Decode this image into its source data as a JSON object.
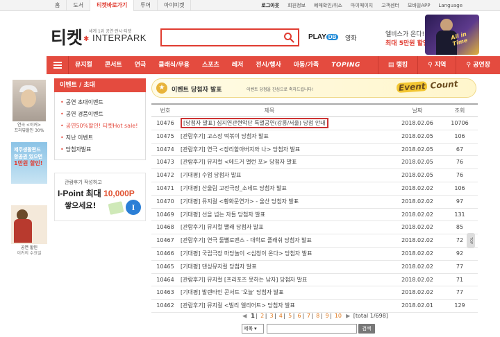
{
  "topbar": {
    "left_tabs": [
      "홈",
      "도서",
      "티켓바로가기",
      "투어",
      "아이미켓"
    ],
    "right_links": [
      "로그아웃",
      "회원정보",
      "예매확인/취소",
      "마이페이지",
      "고객센터",
      "모바일APP",
      "Language"
    ]
  },
  "header": {
    "logo_ticket": "티켓",
    "logo_sub": "세계 1위 공연·전시·티켓",
    "logo_interpark": "INTERPARK",
    "playdb": "PLAY",
    "playdb_badge": "DB",
    "movie": "영화",
    "promo_line1": "엘비스가 온다!",
    "promo_line2": "최대 5만원 할인",
    "promo_art_text": "All in Time"
  },
  "nav": {
    "items": [
      "뮤지컬",
      "콘서트",
      "연극",
      "클래식/무용",
      "스포츠",
      "레저",
      "전시/행사",
      "아동/가족",
      "TOPING"
    ],
    "right_items": [
      "랭킹",
      "지역",
      "공연장"
    ]
  },
  "left_banners": {
    "b1_caption1": "연극 <이커>",
    "b1_caption2": "프리뷰할인 30%",
    "b2_text1": "제주생활편드",
    "b2_text2": "항공권 있으면",
    "b2_text3": "1만원 할인!",
    "b3_caption1": "공연 할인",
    "b3_caption2": "이커의 수요일"
  },
  "event_sidebar": {
    "header": "이벤트 / 초대",
    "items": [
      {
        "label": "공연 초대이벤트",
        "hot": false
      },
      {
        "label": "공연 경품이벤트",
        "hot": false
      },
      {
        "label": "공연50%할인! 티켓Hot sale!",
        "hot": true
      },
      {
        "label": "지난 이벤트",
        "hot": false
      },
      {
        "label": "당첨자발표",
        "hot": false
      }
    ],
    "ipoint": {
      "line1": "관람후기 작성하고",
      "line2_prefix": "I-Point 최대 ",
      "line2_num": "10,000P",
      "line3": "쌓으세요!",
      "badge": "I"
    }
  },
  "main": {
    "title": "이벤트 당첨자 발표",
    "subtitle": "이벤트 당첨을 진심으로 축하드립니다!",
    "banner_logo": "Event",
    "banner_logo_suffix": "Count",
    "columns": {
      "num": "번호",
      "title": "제목",
      "date": "날짜",
      "views": "조회"
    },
    "rows": [
      {
        "num": "10476",
        "title": "[당첨자 발표] 심지연관현악단 특별공연(강릉/서울) 당첨 안내",
        "date": "2018.02.06",
        "views": "10706",
        "highlight": true
      },
      {
        "num": "10475",
        "title": "[관람후기] 고스장 떡볶이 당첨자 발표",
        "date": "2018.02.05",
        "views": "106"
      },
      {
        "num": "10474",
        "title": "[관람후기] 연극 <장리할아버지와 나> 당첨자 발표",
        "date": "2018.02.05",
        "views": "67"
      },
      {
        "num": "10473",
        "title": "[관람후기] 뮤지컬 <에드거 앨런 포> 당첨자 발표",
        "date": "2018.02.05",
        "views": "76"
      },
      {
        "num": "10472",
        "title": "[기대평] 수업 당첨자 발표",
        "date": "2018.02.05",
        "views": "76"
      },
      {
        "num": "10471",
        "title": "[기대평] 산울림 고전극장_소네트 당첨자 발표",
        "date": "2018.02.02",
        "views": "106"
      },
      {
        "num": "10470",
        "title": "[기대평] 뮤지컬 <황화문연가> - 울산 당첨자 발표",
        "date": "2018.02.02",
        "views": "97"
      },
      {
        "num": "10469",
        "title": "[기대평] 선을 넘는 자들 당첨자 발표",
        "date": "2018.02.02",
        "views": "131"
      },
      {
        "num": "10468",
        "title": "[관람후기] 뮤지컬 빨래 당첨자 발표",
        "date": "2018.02.02",
        "views": "85"
      },
      {
        "num": "10467",
        "title": "[관람후기] 연극 둘뻘로맨스 - 대학로 플래쉬 당첨자 발표",
        "date": "2018.02.02",
        "views": "72"
      },
      {
        "num": "10466",
        "title": "[기대평] 국립극장 마당놀이 <심청이 온다> 당첨자 발표",
        "date": "2018.02.02",
        "views": "92"
      },
      {
        "num": "10465",
        "title": "[기대평] 댄싱뮤지컬 당첨자 발표",
        "date": "2018.02.02",
        "views": "77"
      },
      {
        "num": "10464",
        "title": "[관람후기] 뮤지컬 [프리포즈 못하는 남자] 당첨자 발표",
        "date": "2018.02.02",
        "views": "71"
      },
      {
        "num": "10463",
        "title": "[기대평] 발렌타인 콘서트 '오늘' 당첨자 발표",
        "date": "2018.02.02",
        "views": "77"
      },
      {
        "num": "10462",
        "title": "[관람후기] 뮤지컬 <빌리 엘리어트> 당첨자 발표",
        "date": "2018.02.01",
        "views": "129"
      }
    ],
    "pager": {
      "first": "◀",
      "pages": [
        "1",
        "2",
        "3",
        "4",
        "5",
        "6",
        "7",
        "8",
        "9",
        "10"
      ],
      "current": "1",
      "next": "▶",
      "total": "[total 1/698]"
    },
    "search": {
      "select_value": "제목",
      "button": "검색"
    }
  },
  "top_button": "TOP"
}
